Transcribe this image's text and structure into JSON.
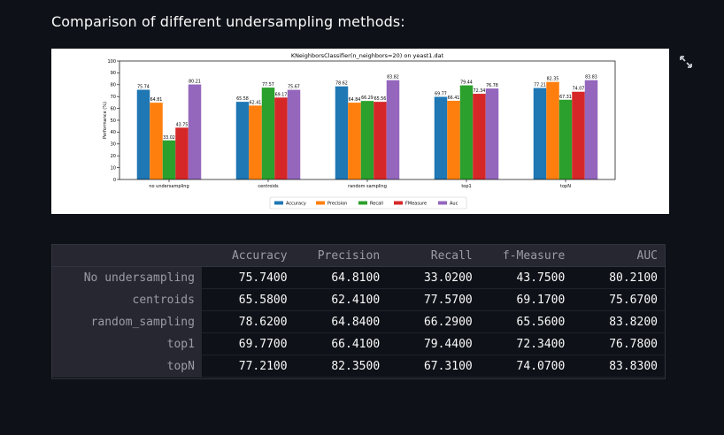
{
  "page": {
    "heading": "Comparison of different undersampling methods:"
  },
  "icons": {
    "expand": "expand-icon"
  },
  "chart_data": {
    "type": "bar",
    "title": "KNeighborsClassifier(n_neighbors=20) on yeast1.dat",
    "ylabel": "Performance (%)",
    "xlabel": "",
    "ylim": [
      0,
      100
    ],
    "yticks": [
      0,
      10,
      20,
      30,
      40,
      50,
      60,
      70,
      80,
      90,
      100
    ],
    "categories": [
      "no undersampling",
      "centroids",
      "random sampling",
      "top1",
      "topN"
    ],
    "legend_position": "bottom-center",
    "series": [
      {
        "name": "Accuracy",
        "color": "#1f77b4",
        "values": [
          75.74,
          65.58,
          78.62,
          69.77,
          77.21
        ]
      },
      {
        "name": "Precision",
        "color": "#ff7f0e",
        "values": [
          64.81,
          62.41,
          64.84,
          66.41,
          82.35
        ]
      },
      {
        "name": "Recall",
        "color": "#2ca02c",
        "values": [
          33.02,
          77.57,
          66.29,
          79.44,
          67.31
        ]
      },
      {
        "name": "FMeasure",
        "color": "#d62728",
        "values": [
          43.75,
          69.17,
          65.56,
          72.34,
          74.07
        ]
      },
      {
        "name": "Auc",
        "color": "#9467bd",
        "values": [
          80.21,
          75.67,
          83.82,
          76.78,
          83.83
        ]
      }
    ]
  },
  "table": {
    "columns": [
      "",
      "Accuracy",
      "Precision",
      "Recall",
      "f-Measure",
      "AUC"
    ],
    "rows": [
      {
        "label": "No undersampling",
        "cells": [
          "75.7400",
          "64.8100",
          "33.0200",
          "43.7500",
          "80.2100"
        ]
      },
      {
        "label": "centroids",
        "cells": [
          "65.5800",
          "62.4100",
          "77.5700",
          "69.1700",
          "75.6700"
        ]
      },
      {
        "label": "random_sampling",
        "cells": [
          "78.6200",
          "64.8400",
          "66.2900",
          "65.5600",
          "83.8200"
        ]
      },
      {
        "label": "top1",
        "cells": [
          "69.7700",
          "66.4100",
          "79.4400",
          "72.3400",
          "76.7800"
        ]
      },
      {
        "label": "topN",
        "cells": [
          "77.2100",
          "82.3500",
          "67.3100",
          "74.0700",
          "83.8300"
        ]
      }
    ]
  }
}
